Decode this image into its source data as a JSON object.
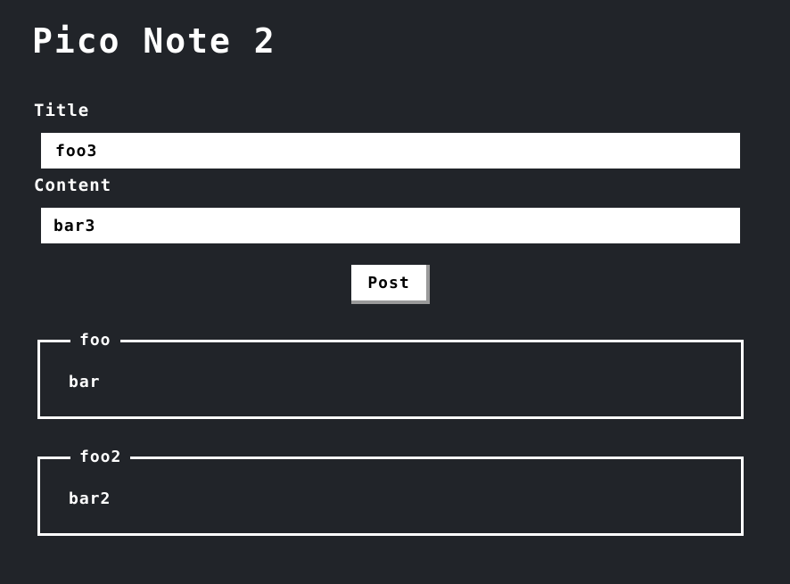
{
  "app": {
    "title": "Pico Note 2"
  },
  "form": {
    "title_label": "Title",
    "title_value": "foo3",
    "content_label": "Content",
    "content_value": "bar3",
    "post_label": "Post"
  },
  "notes": [
    {
      "title": "foo",
      "content": "bar"
    },
    {
      "title": "foo2",
      "content": "bar2"
    }
  ],
  "colors": {
    "background": "#212429",
    "foreground": "#ffffff",
    "input_background": "#ffffff",
    "button_shadow": "#9a9a9a"
  }
}
